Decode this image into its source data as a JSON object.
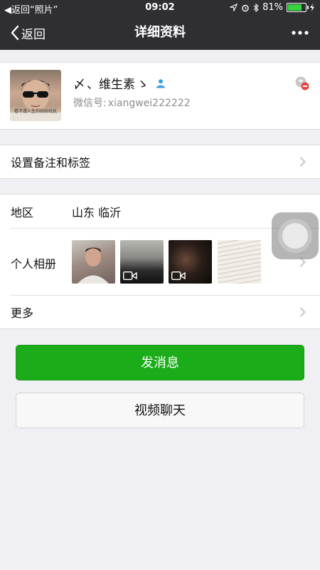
{
  "status_bar": {
    "back_app": "◀返回“照片”",
    "time": "09:02",
    "battery": "81%",
    "battery_level": 0.81
  },
  "nav": {
    "back_label": "返回",
    "title": "详细资料",
    "more_icon": "ellipsis-icon"
  },
  "profile": {
    "nickname_prefix": "〆",
    "nickname_mid": "、维生素",
    "nickname_suffix": "ゝ",
    "avatar_caption": "看不透人生的纷纷扰扰",
    "wechat_id_label": "微信号:",
    "wechat_id": "xiangwei222222"
  },
  "remark": {
    "label": "设置备注和标签"
  },
  "info": {
    "region_label": "地区",
    "region_value": "山东  临沂",
    "album_label": "个人相册",
    "more_label": "更多"
  },
  "actions": {
    "send_message": "发消息",
    "video_chat": "视频聊天"
  },
  "colors": {
    "bar": "#2f2f33",
    "primary_green": "#1aad19",
    "background": "#efeff4"
  }
}
